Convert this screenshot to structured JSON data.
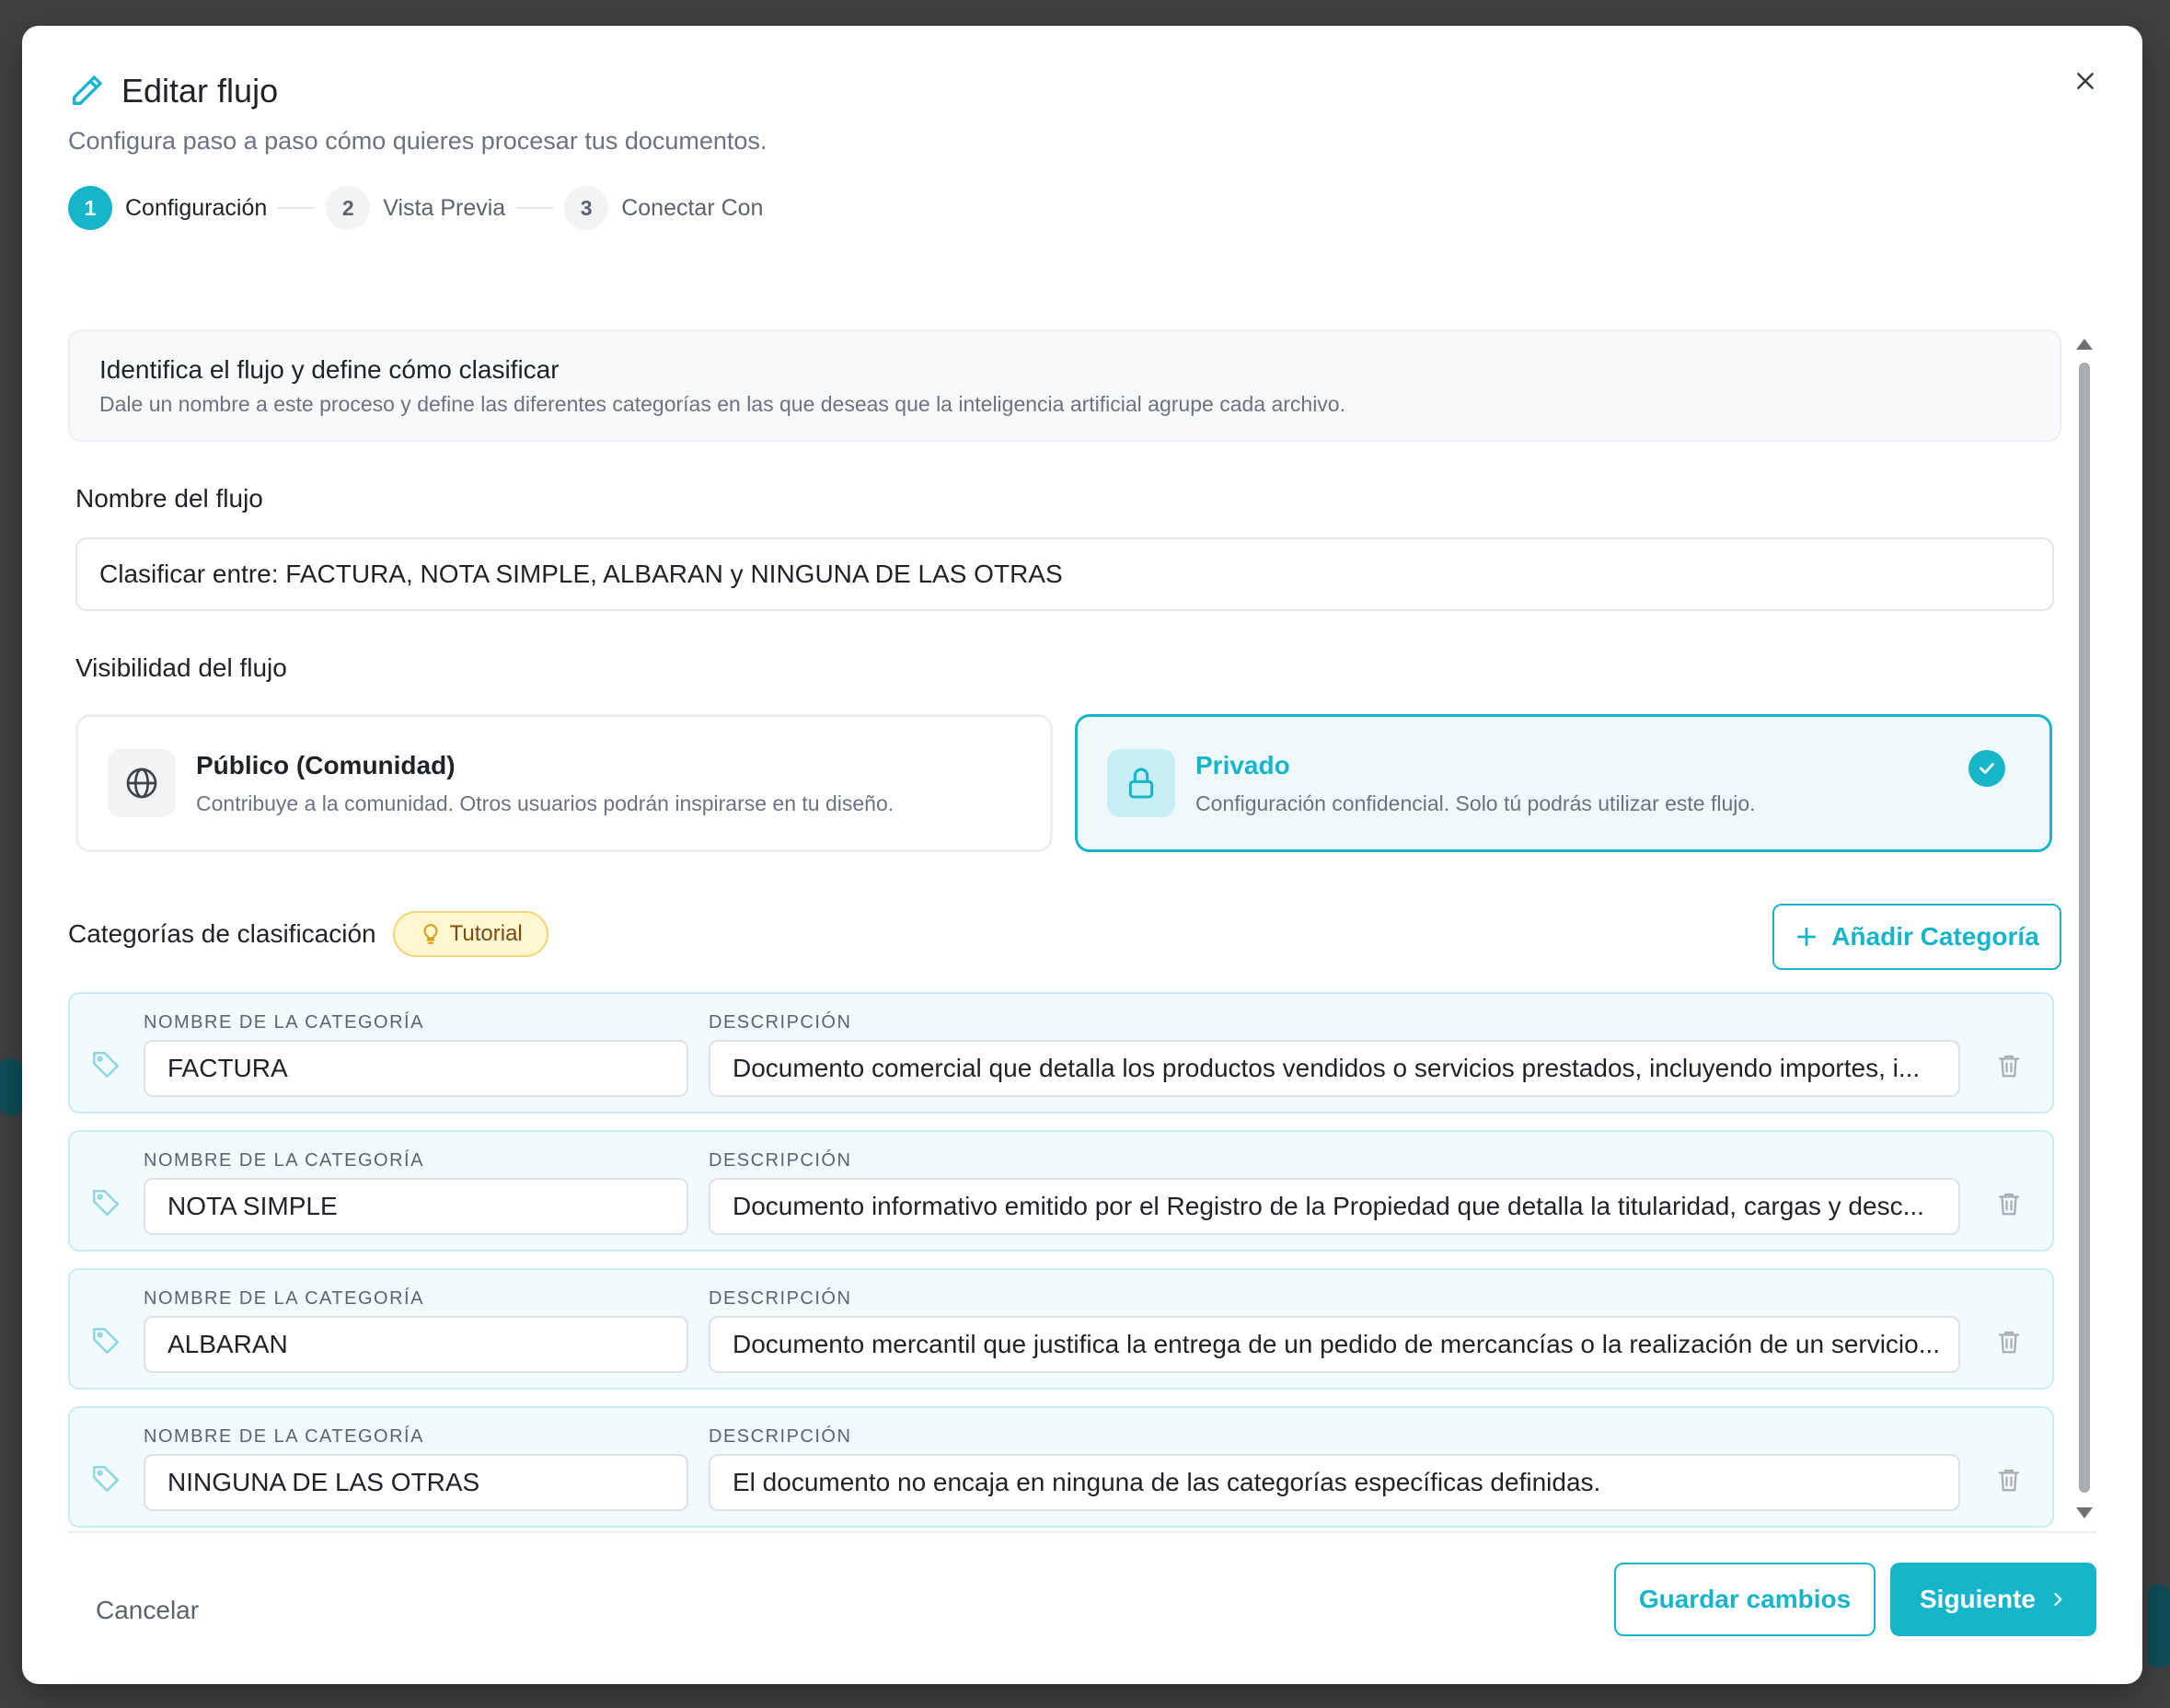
{
  "modal": {
    "title": "Editar flujo",
    "subtitle": "Configura paso a paso cómo quieres procesar tus documentos."
  },
  "stepper": {
    "steps": [
      {
        "number": "1",
        "label": "Configuración",
        "active": true
      },
      {
        "number": "2",
        "label": "Vista Previa",
        "active": false
      },
      {
        "number": "3",
        "label": "Conectar Con",
        "active": false
      }
    ]
  },
  "info": {
    "title": "Identifica el flujo y define cómo clasificar",
    "description": "Dale un nombre a este proceso y define las diferentes categorías en las que deseas que la inteligencia artificial agrupe cada archivo."
  },
  "flow_name": {
    "label": "Nombre del flujo",
    "value": "Clasificar entre: FACTURA, NOTA SIMPLE, ALBARAN y NINGUNA DE LAS OTRAS"
  },
  "visibility": {
    "label": "Visibilidad del flujo",
    "options": [
      {
        "title": "Público (Comunidad)",
        "description": "Contribuye a la comunidad. Otros usuarios podrán inspirarse en tu diseño.",
        "selected": false,
        "icon": "globe-icon"
      },
      {
        "title": "Privado",
        "description": "Configuración confidencial. Solo tú podrás utilizar este flujo.",
        "selected": true,
        "icon": "lock-icon"
      }
    ]
  },
  "categories": {
    "title": "Categorías de clasificación",
    "tutorial_label": "Tutorial",
    "add_label": "Añadir Categoría",
    "name_column": "NOMBRE DE LA CATEGORÍA",
    "description_column": "DESCRIPCIÓN",
    "items": [
      {
        "name": "FACTURA",
        "description": "Documento comercial que detalla los productos vendidos o servicios prestados, incluyendo importes, i..."
      },
      {
        "name": "NOTA SIMPLE",
        "description": "Documento informativo emitido por el Registro de la Propiedad que detalla la titularidad, cargas y desc..."
      },
      {
        "name": "ALBARAN",
        "description": "Documento mercantil que justifica la entrega de un pedido de mercancías o la realización de un servicio..."
      },
      {
        "name": "NINGUNA DE LAS OTRAS",
        "description": "El documento no encaja en ninguna de las categorías específicas definidas."
      }
    ]
  },
  "footer": {
    "cancel_label": "Cancelar",
    "save_label": "Guardar cambios",
    "next_label": "Siguiente"
  },
  "colors": {
    "accent": "#17b5ca",
    "tutorial_bg": "#fdf6cf",
    "row_bg": "#f1fafc"
  }
}
